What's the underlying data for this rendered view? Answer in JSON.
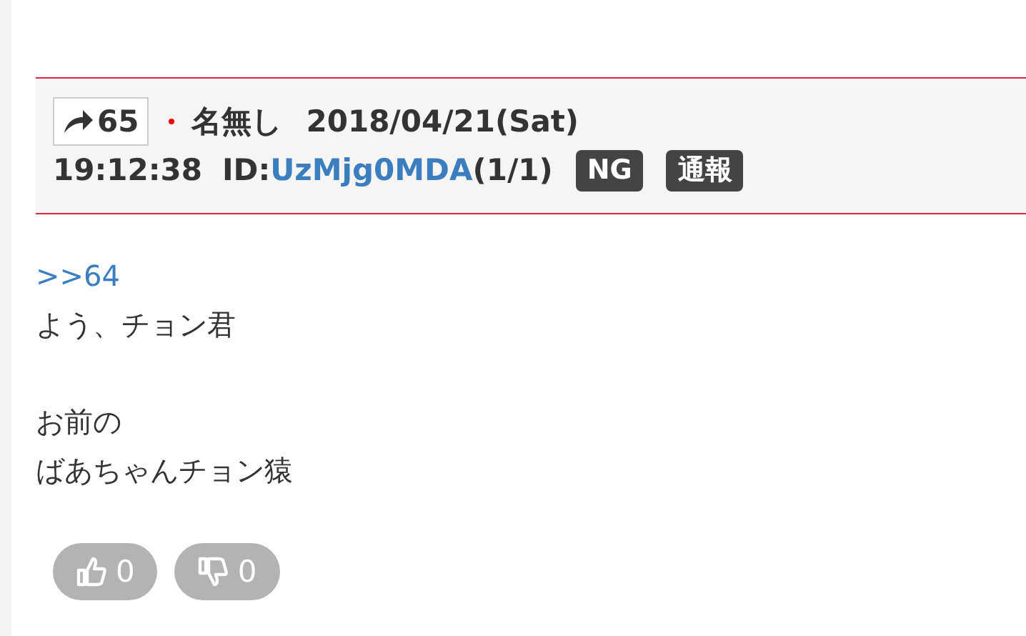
{
  "post": {
    "number": "65",
    "name": "名無し",
    "date": "2018/04/21(Sat)",
    "time": "19:12:38",
    "id_label": "ID:",
    "id": "UzMjg0MDA",
    "id_count": "(1/1)",
    "actions": [
      "NG",
      "通報"
    ],
    "paragraphs": [
      {
        "lines": [
          {
            "kind": "anchor",
            "text": ">>64"
          },
          {
            "kind": "text",
            "text": "よう、チョン君"
          }
        ]
      },
      {
        "lines": [
          {
            "kind": "text",
            "text": "お前の"
          },
          {
            "kind": "text",
            "text": "ばあちゃんチョン猿"
          }
        ]
      }
    ],
    "votes": [
      {
        "kind": "up",
        "count": "0"
      },
      {
        "kind": "down",
        "count": "0"
      }
    ]
  }
}
